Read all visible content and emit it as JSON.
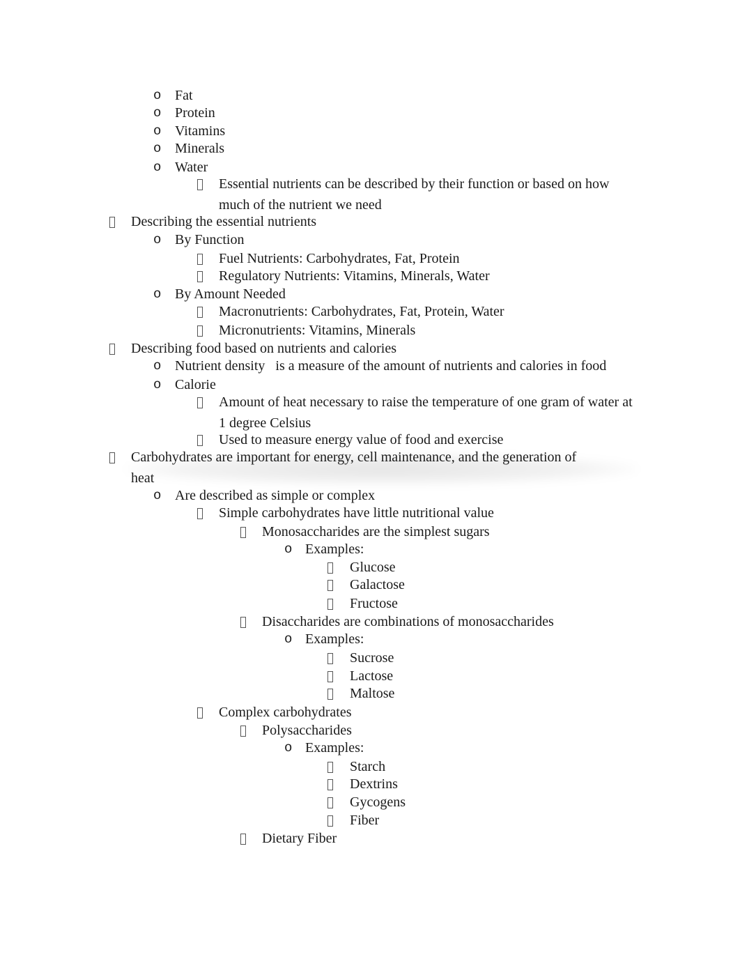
{
  "document": {
    "lines": [
      {
        "level": 2,
        "bullet": "o",
        "text": "Fat"
      },
      {
        "level": 2,
        "bullet": "o",
        "text": "Protein"
      },
      {
        "level": 2,
        "bullet": "o",
        "text": "Vitamins"
      },
      {
        "level": 2,
        "bullet": "o",
        "text": "Minerals"
      },
      {
        "level": 2,
        "bullet": "o",
        "text": "Water"
      },
      {
        "level": 3,
        "bullet": "box",
        "text": "Essential nutrients can be described by their function or based on how"
      },
      {
        "level": 3,
        "bullet": "none",
        "text": "much of the nutrient we need"
      },
      {
        "level": 1,
        "bullet": "box",
        "text": "Describing the essential nutrients"
      },
      {
        "level": 2,
        "bullet": "o",
        "text": "By Function"
      },
      {
        "level": 3,
        "bullet": "box",
        "text": "Fuel Nutrients: Carbohydrates, Fat, Protein"
      },
      {
        "level": 3,
        "bullet": "box",
        "text": "Regulatory Nutrients: Vitamins, Minerals, Water"
      },
      {
        "level": 2,
        "bullet": "o",
        "text": "By Amount Needed"
      },
      {
        "level": 3,
        "bullet": "box",
        "text": "Macronutrients: Carbohydrates, Fat, Protein, Water"
      },
      {
        "level": 3,
        "bullet": "box",
        "text": "Micronutrients: Vitamins, Minerals"
      },
      {
        "level": 1,
        "bullet": "box",
        "text": "Describing food based on nutrients and calories"
      },
      {
        "level": 2,
        "bullet": "o",
        "text": "Nutrient density   is a measure of the amount of nutrients and calories in food"
      },
      {
        "level": 2,
        "bullet": "o",
        "text": "Calorie"
      },
      {
        "level": 3,
        "bullet": "box",
        "text": "Amount of heat necessary to raise the temperature of one gram of water at"
      },
      {
        "level": 3,
        "bullet": "none",
        "text": "1 degree Celsius"
      },
      {
        "level": 3,
        "bullet": "box",
        "text": "Used to measure energy value of food and exercise"
      },
      {
        "level": 1,
        "bullet": "box",
        "text": "Carbohydrates are important for energy, cell maintenance, and the generation of"
      },
      {
        "level": 1,
        "bullet": "none",
        "text": "heat"
      },
      {
        "level": 2,
        "bullet": "o",
        "text": "Are described as simple or complex"
      },
      {
        "level": 3,
        "bullet": "box",
        "text": "Simple carbohydrates have little nutritional value"
      },
      {
        "level": 4,
        "bullet": "box",
        "text": "Monosaccharides are the simplest sugars"
      },
      {
        "level": 5,
        "bullet": "o",
        "text": "Examples:"
      },
      {
        "level": 6,
        "bullet": "box",
        "text": "Glucose"
      },
      {
        "level": 6,
        "bullet": "box",
        "text": "Galactose"
      },
      {
        "level": 6,
        "bullet": "box",
        "text": "Fructose"
      },
      {
        "level": 4,
        "bullet": "box",
        "text": "Disaccharides are combinations of monosaccharides"
      },
      {
        "level": 5,
        "bullet": "o",
        "text": "Examples:"
      },
      {
        "level": 6,
        "bullet": "box",
        "text": "Sucrose"
      },
      {
        "level": 6,
        "bullet": "box",
        "text": "Lactose"
      },
      {
        "level": 6,
        "bullet": "box",
        "text": "Maltose"
      },
      {
        "level": 3,
        "bullet": "box",
        "text": "Complex carbohydrates"
      },
      {
        "level": 4,
        "bullet": "box",
        "text": "Polysaccharides"
      },
      {
        "level": 5,
        "bullet": "o",
        "text": "Examples:"
      },
      {
        "level": 6,
        "bullet": "box",
        "text": "Starch"
      },
      {
        "level": 6,
        "bullet": "box",
        "text": "Dextrins"
      },
      {
        "level": 6,
        "bullet": "box",
        "text": "Gycogens"
      },
      {
        "level": 6,
        "bullet": "box",
        "text": "Fiber"
      },
      {
        "level": 4,
        "bullet": "box",
        "text": "Dietary Fiber"
      }
    ]
  }
}
